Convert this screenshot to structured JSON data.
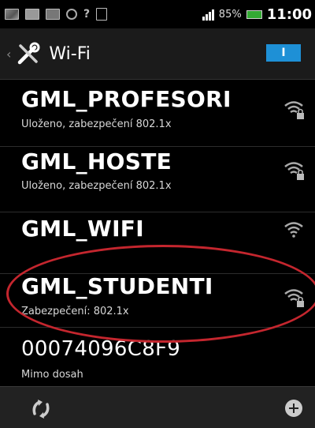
{
  "status_bar": {
    "icons": [
      "image-icon",
      "mail-icon",
      "mail-icon",
      "notification-icon",
      "help-icon",
      "calendar-icon"
    ],
    "signal_icon": "signal-icon",
    "battery_text": "85%",
    "battery_icon": "battery-icon",
    "time": "11:00"
  },
  "action_bar": {
    "back_icon": "back-caret-icon",
    "settings_icon": "tools-icon",
    "title": "Wi-Fi",
    "toggle_label": "I",
    "toggle_color": "#1e90d6"
  },
  "networks": [
    {
      "ssid": "GML_PROFESORI",
      "status": "Uloženo, zabezpečení 802.1x",
      "icon": "wifi-locked-icon"
    },
    {
      "ssid": "GML_HOSTE",
      "status": "Uloženo, zabezpečení 802.1x",
      "icon": "wifi-locked-icon"
    },
    {
      "ssid": "GML_WIFI",
      "status": "",
      "icon": "wifi-icon"
    },
    {
      "ssid": "GML_STUDENTI",
      "status": "Zabezpečení: 802.1x",
      "icon": "wifi-locked-icon"
    },
    {
      "ssid": "00074096C8F9",
      "status": "Mimo dosah",
      "icon": ""
    }
  ],
  "highlight_color": "#c4262e",
  "bottom_bar": {
    "scan_icon": "refresh-icon",
    "add_icon": "add-icon"
  }
}
